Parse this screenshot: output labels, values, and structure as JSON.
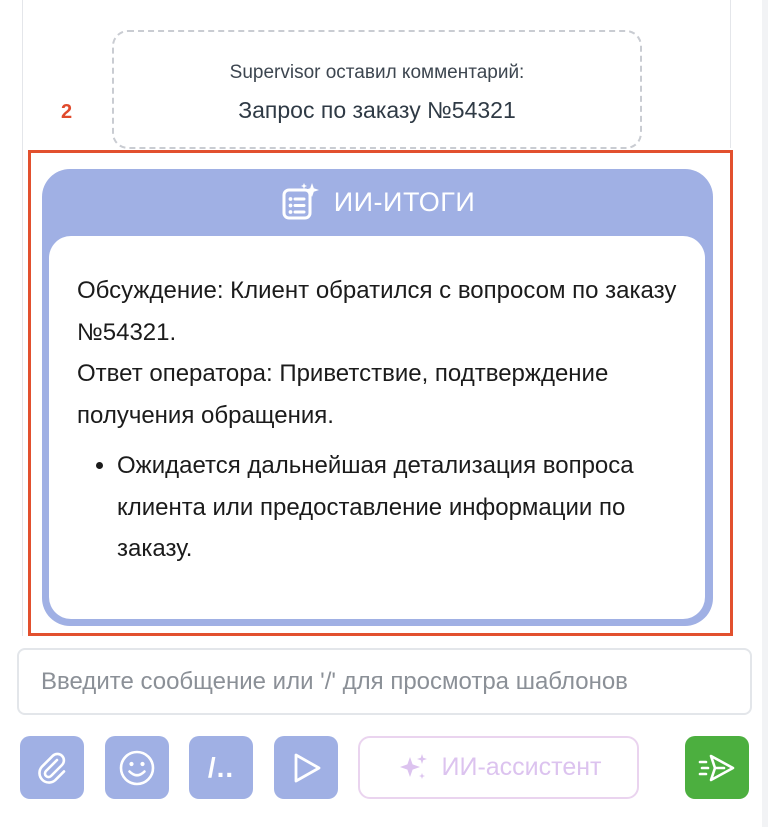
{
  "comment": {
    "author_line": "Supervisor оставил комментарий:",
    "text": "Запрос по заказу №54321"
  },
  "step_marker": "2",
  "ai_summary": {
    "title": "ИИ-ИТОГИ",
    "discussion": "Обсуждение: Клиент обратился с вопросом по заказу №54321.",
    "operator_reply": "Ответ оператора: Приветствие, подтверждение получения обращения.",
    "bullets": [
      "Ожидается дальнейшая детализация вопроса клиента или предоставление информации по заказу."
    ]
  },
  "composer": {
    "placeholder": "Введите сообщение или '/' для просмотра шаблонов",
    "value": ""
  },
  "toolbar": {
    "attach_icon": "paperclip-icon",
    "emoji_icon": "smiley-icon",
    "templates_label": "/..",
    "play_icon": "play-triangle-icon",
    "ai_assistant_label": "ИИ-ассистент",
    "send_icon": "send-icon"
  },
  "colors": {
    "accent": "#a0b0e4",
    "highlight": "#e2502e",
    "send": "#4caf3f",
    "ai_assistant_text": "#dcc3ef"
  }
}
